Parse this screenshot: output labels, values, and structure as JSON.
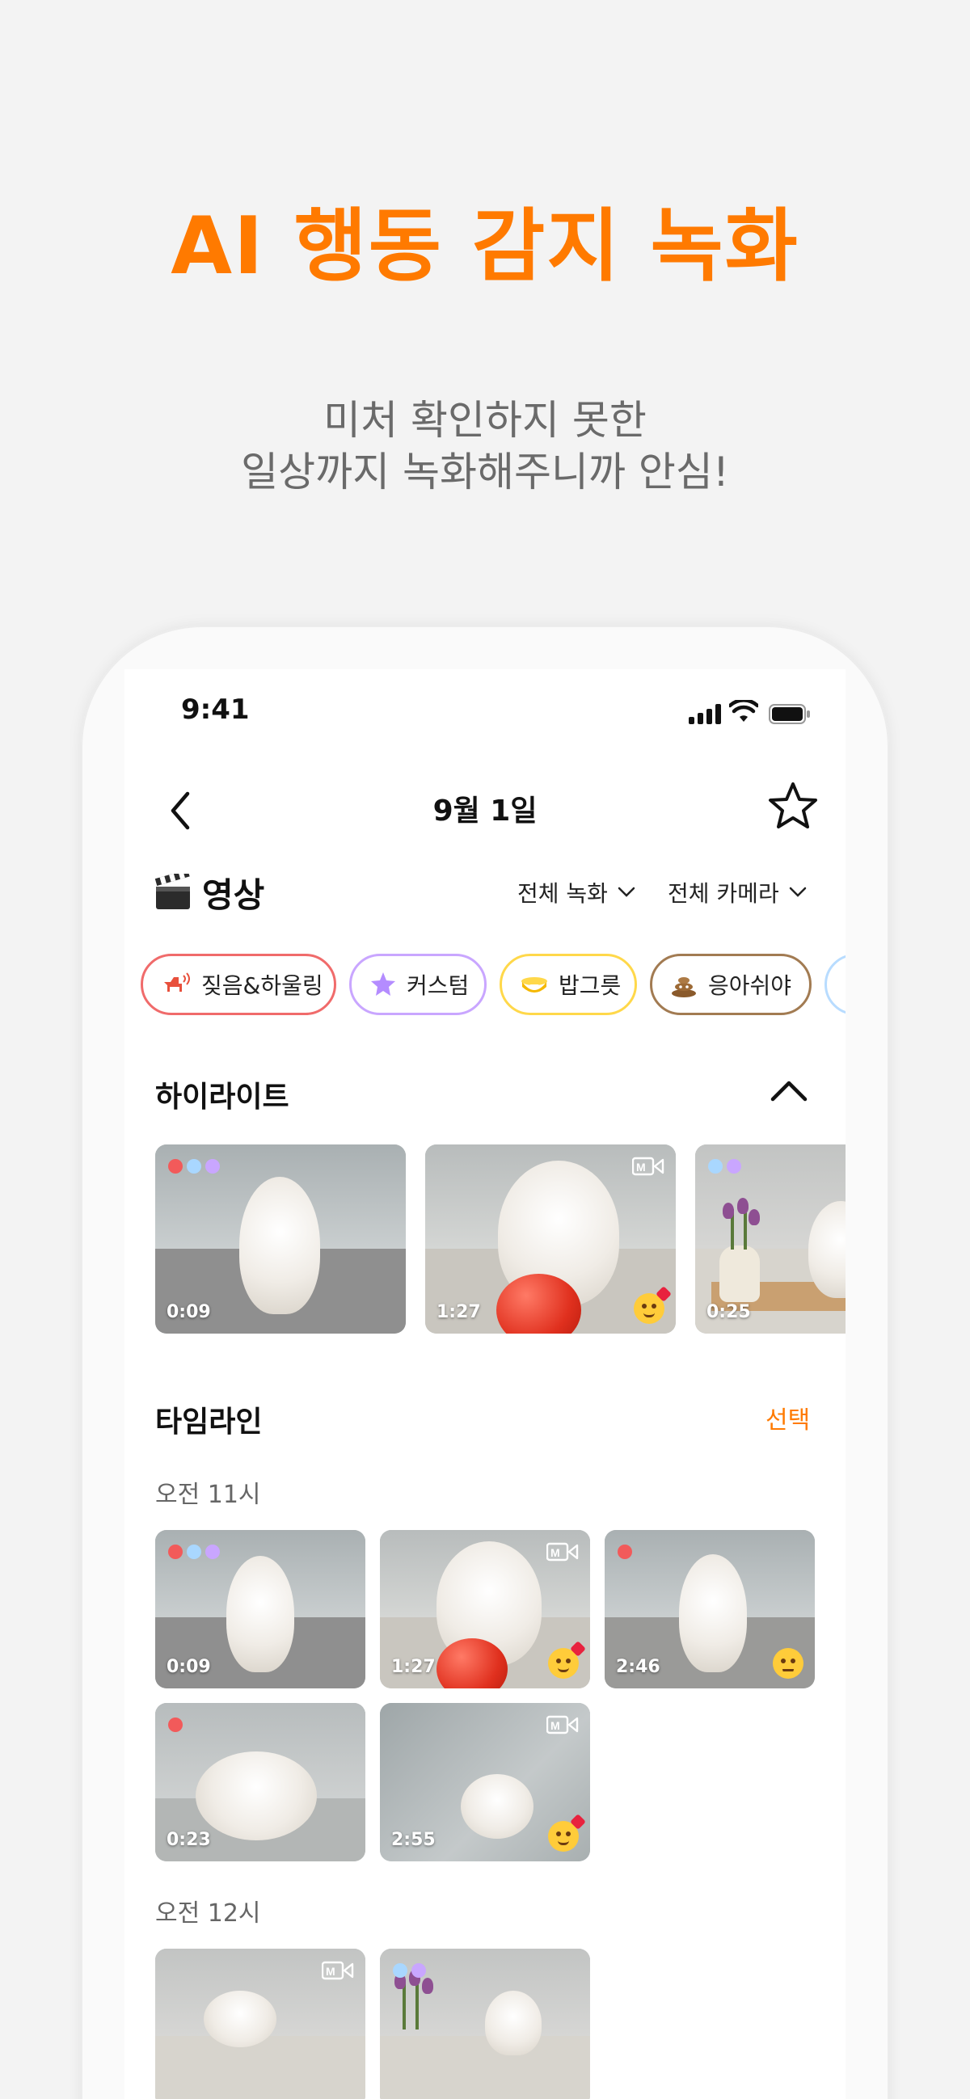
{
  "promo": {
    "title": "AI 행동 감지 녹화",
    "subtitle_line1": "미처 확인하지 못한",
    "subtitle_line2": "일상까지 녹화해주니까 안심!"
  },
  "status_bar": {
    "time": "9:41"
  },
  "nav": {
    "title": "9월 1일"
  },
  "video_section": {
    "title": "영상",
    "filter_recording": "전체 녹화",
    "filter_camera": "전체 카메라"
  },
  "chips": [
    {
      "label": "짖음&하울링",
      "border": "#f06b6b"
    },
    {
      "label": "커스텀",
      "border": "#c9a6ff"
    },
    {
      "label": "밥그릇",
      "border": "#ffd84a"
    },
    {
      "label": "응아쉬야",
      "border": "#a27b52"
    }
  ],
  "highlight": {
    "title": "하이라이트",
    "items": [
      {
        "time": "0:09"
      },
      {
        "time": "1:27"
      },
      {
        "time": "0:25"
      }
    ]
  },
  "timeline": {
    "title": "타임라인",
    "select_label": "선택",
    "groups": [
      {
        "hour": "오전 11시",
        "items": [
          {
            "time": "0:09"
          },
          {
            "time": "1:27"
          },
          {
            "time": "2:46"
          },
          {
            "time": "0:23"
          },
          {
            "time": "2:55"
          }
        ]
      },
      {
        "hour": "오전 12시",
        "items": [
          {},
          {}
        ]
      }
    ]
  },
  "colors": {
    "accent": "#ff7a00",
    "dot_red": "#f25a5a",
    "dot_blue": "#a9d7ff",
    "dot_purple": "#c9a6ff"
  }
}
